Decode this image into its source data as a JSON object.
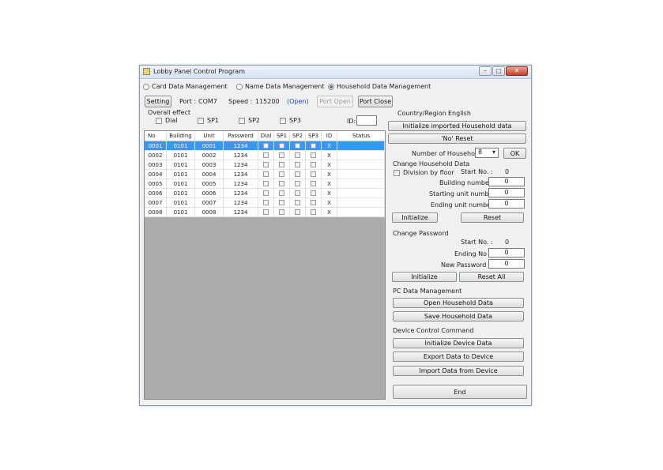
{
  "window": {
    "title": "Lobby Panel Control Program"
  },
  "tabs": [
    {
      "label": "Card Data Management",
      "selected": false
    },
    {
      "label": "Name Data Management",
      "selected": false
    },
    {
      "label": "Household Data Management",
      "selected": true
    }
  ],
  "toolbar": {
    "setting_label": "Setting",
    "port_label": "Port :",
    "port_value": "COM7",
    "speed_label": "Speed :",
    "speed_value": "115200",
    "status": "(Open)",
    "port_open_label": "Port Open",
    "port_close_label": "Port Close"
  },
  "overall_effect": {
    "title": "Overall effect",
    "options": [
      "Dial",
      "SP1",
      "SP2",
      "SP3"
    ],
    "id_label": "ID:",
    "id_value": ""
  },
  "table": {
    "columns": [
      "No",
      "Building",
      "Unit",
      "Password",
      "Dial",
      "SP1",
      "SP2",
      "SP3",
      "ID",
      "Status"
    ],
    "rows": [
      {
        "no": "0001",
        "building": "0101",
        "unit": "0001",
        "password": "1234",
        "id": "X",
        "status": ""
      },
      {
        "no": "0002",
        "building": "0101",
        "unit": "0002",
        "password": "1234",
        "id": "X",
        "status": ""
      },
      {
        "no": "0003",
        "building": "0101",
        "unit": "0003",
        "password": "1234",
        "id": "X",
        "status": ""
      },
      {
        "no": "0004",
        "building": "0101",
        "unit": "0004",
        "password": "1234",
        "id": "X",
        "status": ""
      },
      {
        "no": "0005",
        "building": "0101",
        "unit": "0005",
        "password": "1234",
        "id": "X",
        "status": ""
      },
      {
        "no": "0006",
        "building": "0101",
        "unit": "0006",
        "password": "1234",
        "id": "X",
        "status": ""
      },
      {
        "no": "0007",
        "building": "0101",
        "unit": "0007",
        "password": "1234",
        "id": "X",
        "status": ""
      },
      {
        "no": "0008",
        "building": "0101",
        "unit": "0008",
        "password": "1234",
        "id": "X",
        "status": ""
      }
    ],
    "selected_row": 0
  },
  "right": {
    "country_label": "Country/Region :",
    "country_value": "English",
    "init_imported_label": "Initialize imported Household data",
    "no_reset_label": "'No' Reset",
    "num_households_label": "Number of Households",
    "num_households_value": "8",
    "ok_label": "OK",
    "change_household": {
      "title": "Change Household Data",
      "division_label": "Division by floor",
      "start_no_label": "Start No. :",
      "start_no_value": "0",
      "building_label": "Building number :",
      "building_value": "0",
      "starting_unit_label": "Starting unit number :",
      "starting_unit_value": "0",
      "ending_unit_label": "Ending unit number :",
      "ending_unit_value": "0",
      "initialize_label": "Initialize",
      "reset_label": "Reset"
    },
    "change_password": {
      "title": "Change Password",
      "start_no_label": "Start No. :",
      "start_no_value": "0",
      "ending_no_label": "Ending No :",
      "ending_no_value": "0",
      "new_password_label": "New Password :",
      "new_password_value": "0",
      "initialize_label": "Initialize",
      "reset_all_label": "Reset All"
    },
    "pc_data": {
      "title": "PC Data Management",
      "open_label": "Open Household Data",
      "save_label": "Save Household Data"
    },
    "device_control": {
      "title": "Device Control Command",
      "init_label": "Initialize Device Data",
      "export_label": "Export Data to Device",
      "import_label": "Import Data from Device"
    },
    "end_label": "End"
  }
}
